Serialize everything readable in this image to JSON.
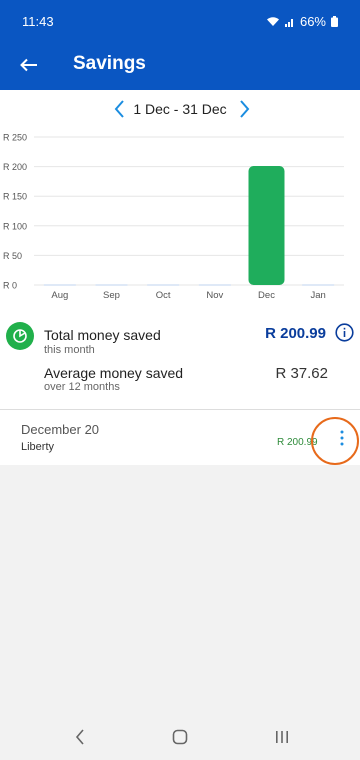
{
  "status": {
    "time": "11:43",
    "battery": "66%"
  },
  "header": {
    "title": "Savings"
  },
  "period": {
    "range_label": "1 Dec - 31 Dec"
  },
  "chart_data": {
    "type": "bar",
    "categories": [
      "Aug",
      "Sep",
      "Oct",
      "Nov",
      "Dec",
      "Jan"
    ],
    "values": [
      0,
      0,
      0,
      0,
      200.99,
      0
    ],
    "y_tick_labels": [
      "R 250",
      "R 200",
      "R 150",
      "R 100",
      "R 50",
      "R 0"
    ],
    "y_ticks": [
      250,
      200,
      150,
      100,
      50,
      0
    ],
    "ylim": [
      0,
      250
    ],
    "grid": true,
    "bar_color": "#1fad5c"
  },
  "summary": {
    "total_label": "Total money saved",
    "total_sub": "this month",
    "total_value": "R 200.99",
    "average_label": "Average money saved",
    "average_sub": "over 12 months",
    "average_value": "R 37.62"
  },
  "transactions": [
    {
      "date": "December 20",
      "name": "Liberty",
      "amount": "R 200.99"
    }
  ],
  "colors": {
    "brand": "#0a56c2",
    "accent": "#1b8de0",
    "positive": "#2e8b3a",
    "highlight": "#e76a1b"
  }
}
